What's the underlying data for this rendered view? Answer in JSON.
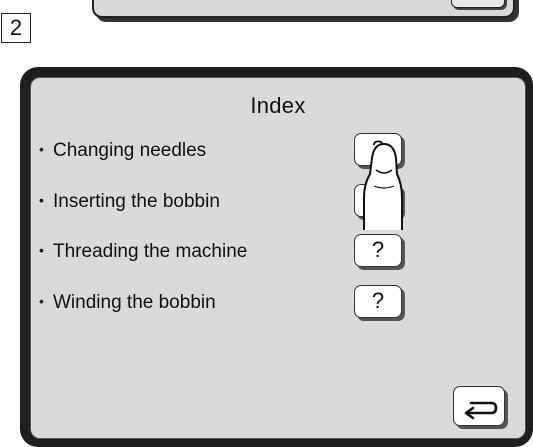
{
  "step_number": "2",
  "panel": {
    "title": "Index",
    "items": [
      {
        "label": "Changing needles",
        "help": "?"
      },
      {
        "label": "Inserting the bobbin",
        "help": "?"
      },
      {
        "label": "Threading the machine",
        "help": "?"
      },
      {
        "label": "Winding the bobbin",
        "help": "?"
      }
    ],
    "bullet": "•",
    "back_icon": "return-arrow-icon",
    "pointer_icon": "pointing-finger-icon"
  }
}
